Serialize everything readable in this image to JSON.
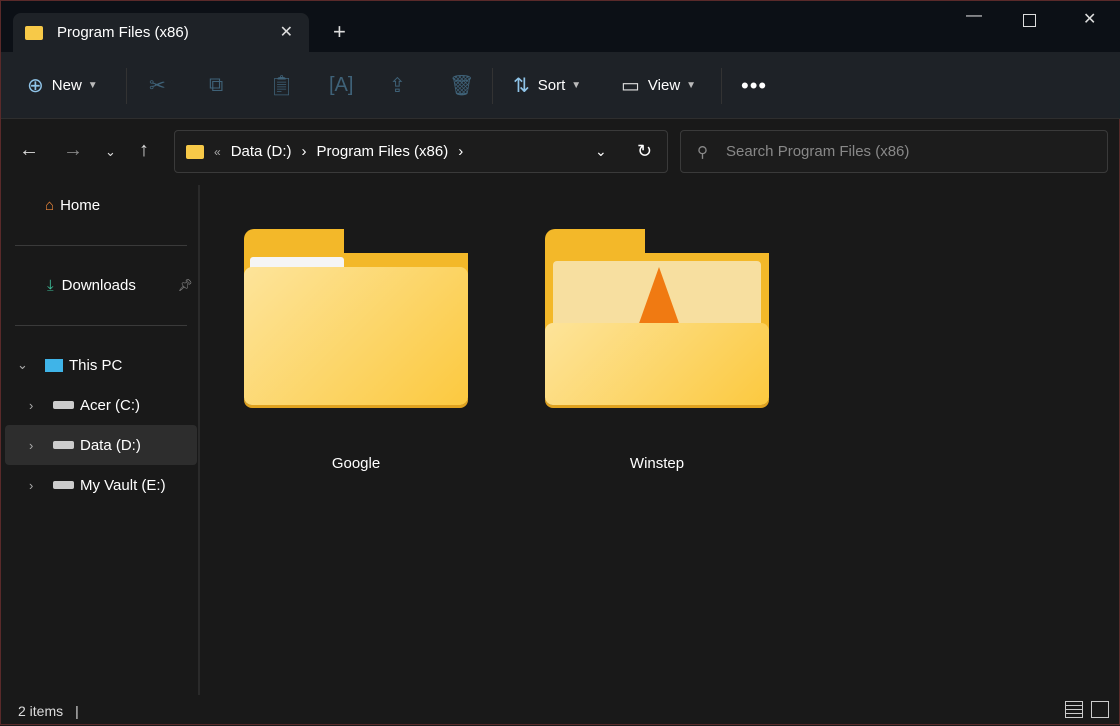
{
  "tab": {
    "title": "Program Files (x86)"
  },
  "toolbar": {
    "new_label": "New",
    "sort_label": "Sort",
    "view_label": "View"
  },
  "address": {
    "crumbs": [
      "Data (D:)",
      "Program Files (x86)"
    ]
  },
  "search": {
    "placeholder": "Search Program Files (x86)"
  },
  "sidebar": {
    "home": "Home",
    "downloads": "Downloads",
    "this_pc": "This PC",
    "drives": [
      "Acer (C:)",
      "Data (D:)",
      "My Vault (E:)"
    ]
  },
  "items": [
    {
      "name": "Google"
    },
    {
      "name": "Winstep"
    }
  ],
  "status": {
    "count": "2 items"
  }
}
